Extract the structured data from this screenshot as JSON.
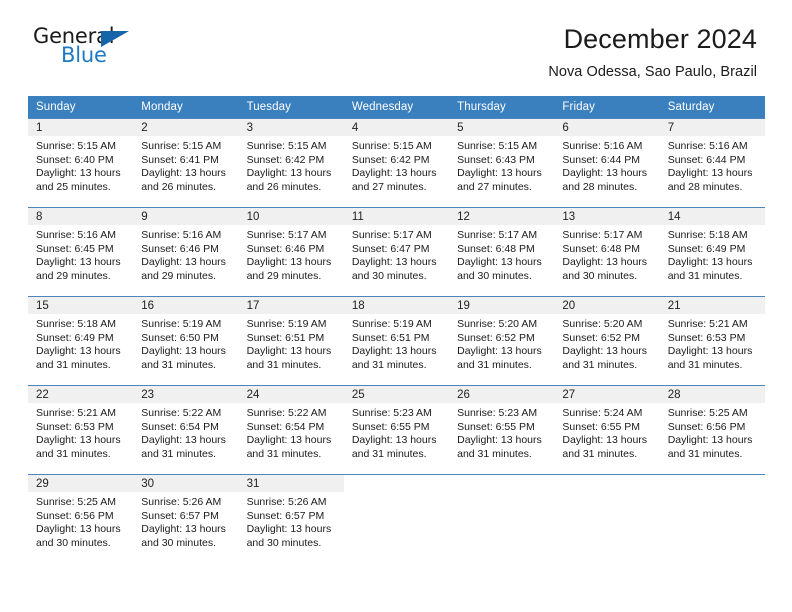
{
  "brand": {
    "name_part1": "General",
    "name_part2": "Blue",
    "triangle_color": "#1565a8",
    "blue_color": "#1f7ac4"
  },
  "header": {
    "title": "December 2024",
    "location": "Nova Odessa, Sao Paulo, Brazil"
  },
  "theme": {
    "header_row_bg": "#3a7fbe",
    "header_row_text": "#ffffff",
    "daynum_bg": "#f0f0f0",
    "cell_border": "#4a86bd",
    "body_text": "#1b1b1b"
  },
  "calendar": {
    "weekday_headers": [
      "Sunday",
      "Monday",
      "Tuesday",
      "Wednesday",
      "Thursday",
      "Friday",
      "Saturday"
    ],
    "labels": {
      "sunrise": "Sunrise:",
      "sunset": "Sunset:",
      "daylight": "Daylight:"
    },
    "weeks": [
      [
        {
          "day": "1",
          "sunrise": "Sunrise: 5:15 AM",
          "sunset": "Sunset: 6:40 PM",
          "daylight_line1": "Daylight: 13 hours",
          "daylight_line2": "and 25 minutes."
        },
        {
          "day": "2",
          "sunrise": "Sunrise: 5:15 AM",
          "sunset": "Sunset: 6:41 PM",
          "daylight_line1": "Daylight: 13 hours",
          "daylight_line2": "and 26 minutes."
        },
        {
          "day": "3",
          "sunrise": "Sunrise: 5:15 AM",
          "sunset": "Sunset: 6:42 PM",
          "daylight_line1": "Daylight: 13 hours",
          "daylight_line2": "and 26 minutes."
        },
        {
          "day": "4",
          "sunrise": "Sunrise: 5:15 AM",
          "sunset": "Sunset: 6:42 PM",
          "daylight_line1": "Daylight: 13 hours",
          "daylight_line2": "and 27 minutes."
        },
        {
          "day": "5",
          "sunrise": "Sunrise: 5:15 AM",
          "sunset": "Sunset: 6:43 PM",
          "daylight_line1": "Daylight: 13 hours",
          "daylight_line2": "and 27 minutes."
        },
        {
          "day": "6",
          "sunrise": "Sunrise: 5:16 AM",
          "sunset": "Sunset: 6:44 PM",
          "daylight_line1": "Daylight: 13 hours",
          "daylight_line2": "and 28 minutes."
        },
        {
          "day": "7",
          "sunrise": "Sunrise: 5:16 AM",
          "sunset": "Sunset: 6:44 PM",
          "daylight_line1": "Daylight: 13 hours",
          "daylight_line2": "and 28 minutes."
        }
      ],
      [
        {
          "day": "8",
          "sunrise": "Sunrise: 5:16 AM",
          "sunset": "Sunset: 6:45 PM",
          "daylight_line1": "Daylight: 13 hours",
          "daylight_line2": "and 29 minutes."
        },
        {
          "day": "9",
          "sunrise": "Sunrise: 5:16 AM",
          "sunset": "Sunset: 6:46 PM",
          "daylight_line1": "Daylight: 13 hours",
          "daylight_line2": "and 29 minutes."
        },
        {
          "day": "10",
          "sunrise": "Sunrise: 5:17 AM",
          "sunset": "Sunset: 6:46 PM",
          "daylight_line1": "Daylight: 13 hours",
          "daylight_line2": "and 29 minutes."
        },
        {
          "day": "11",
          "sunrise": "Sunrise: 5:17 AM",
          "sunset": "Sunset: 6:47 PM",
          "daylight_line1": "Daylight: 13 hours",
          "daylight_line2": "and 30 minutes."
        },
        {
          "day": "12",
          "sunrise": "Sunrise: 5:17 AM",
          "sunset": "Sunset: 6:48 PM",
          "daylight_line1": "Daylight: 13 hours",
          "daylight_line2": "and 30 minutes."
        },
        {
          "day": "13",
          "sunrise": "Sunrise: 5:17 AM",
          "sunset": "Sunset: 6:48 PM",
          "daylight_line1": "Daylight: 13 hours",
          "daylight_line2": "and 30 minutes."
        },
        {
          "day": "14",
          "sunrise": "Sunrise: 5:18 AM",
          "sunset": "Sunset: 6:49 PM",
          "daylight_line1": "Daylight: 13 hours",
          "daylight_line2": "and 31 minutes."
        }
      ],
      [
        {
          "day": "15",
          "sunrise": "Sunrise: 5:18 AM",
          "sunset": "Sunset: 6:49 PM",
          "daylight_line1": "Daylight: 13 hours",
          "daylight_line2": "and 31 minutes."
        },
        {
          "day": "16",
          "sunrise": "Sunrise: 5:19 AM",
          "sunset": "Sunset: 6:50 PM",
          "daylight_line1": "Daylight: 13 hours",
          "daylight_line2": "and 31 minutes."
        },
        {
          "day": "17",
          "sunrise": "Sunrise: 5:19 AM",
          "sunset": "Sunset: 6:51 PM",
          "daylight_line1": "Daylight: 13 hours",
          "daylight_line2": "and 31 minutes."
        },
        {
          "day": "18",
          "sunrise": "Sunrise: 5:19 AM",
          "sunset": "Sunset: 6:51 PM",
          "daylight_line1": "Daylight: 13 hours",
          "daylight_line2": "and 31 minutes."
        },
        {
          "day": "19",
          "sunrise": "Sunrise: 5:20 AM",
          "sunset": "Sunset: 6:52 PM",
          "daylight_line1": "Daylight: 13 hours",
          "daylight_line2": "and 31 minutes."
        },
        {
          "day": "20",
          "sunrise": "Sunrise: 5:20 AM",
          "sunset": "Sunset: 6:52 PM",
          "daylight_line1": "Daylight: 13 hours",
          "daylight_line2": "and 31 minutes."
        },
        {
          "day": "21",
          "sunrise": "Sunrise: 5:21 AM",
          "sunset": "Sunset: 6:53 PM",
          "daylight_line1": "Daylight: 13 hours",
          "daylight_line2": "and 31 minutes."
        }
      ],
      [
        {
          "day": "22",
          "sunrise": "Sunrise: 5:21 AM",
          "sunset": "Sunset: 6:53 PM",
          "daylight_line1": "Daylight: 13 hours",
          "daylight_line2": "and 31 minutes."
        },
        {
          "day": "23",
          "sunrise": "Sunrise: 5:22 AM",
          "sunset": "Sunset: 6:54 PM",
          "daylight_line1": "Daylight: 13 hours",
          "daylight_line2": "and 31 minutes."
        },
        {
          "day": "24",
          "sunrise": "Sunrise: 5:22 AM",
          "sunset": "Sunset: 6:54 PM",
          "daylight_line1": "Daylight: 13 hours",
          "daylight_line2": "and 31 minutes."
        },
        {
          "day": "25",
          "sunrise": "Sunrise: 5:23 AM",
          "sunset": "Sunset: 6:55 PM",
          "daylight_line1": "Daylight: 13 hours",
          "daylight_line2": "and 31 minutes."
        },
        {
          "day": "26",
          "sunrise": "Sunrise: 5:23 AM",
          "sunset": "Sunset: 6:55 PM",
          "daylight_line1": "Daylight: 13 hours",
          "daylight_line2": "and 31 minutes."
        },
        {
          "day": "27",
          "sunrise": "Sunrise: 5:24 AM",
          "sunset": "Sunset: 6:55 PM",
          "daylight_line1": "Daylight: 13 hours",
          "daylight_line2": "and 31 minutes."
        },
        {
          "day": "28",
          "sunrise": "Sunrise: 5:25 AM",
          "sunset": "Sunset: 6:56 PM",
          "daylight_line1": "Daylight: 13 hours",
          "daylight_line2": "and 31 minutes."
        }
      ],
      [
        {
          "day": "29",
          "sunrise": "Sunrise: 5:25 AM",
          "sunset": "Sunset: 6:56 PM",
          "daylight_line1": "Daylight: 13 hours",
          "daylight_line2": "and 30 minutes."
        },
        {
          "day": "30",
          "sunrise": "Sunrise: 5:26 AM",
          "sunset": "Sunset: 6:57 PM",
          "daylight_line1": "Daylight: 13 hours",
          "daylight_line2": "and 30 minutes."
        },
        {
          "day": "31",
          "sunrise": "Sunrise: 5:26 AM",
          "sunset": "Sunset: 6:57 PM",
          "daylight_line1": "Daylight: 13 hours",
          "daylight_line2": "and 30 minutes."
        },
        {
          "day": "",
          "sunrise": "",
          "sunset": "",
          "daylight_line1": "",
          "daylight_line2": ""
        },
        {
          "day": "",
          "sunrise": "",
          "sunset": "",
          "daylight_line1": "",
          "daylight_line2": ""
        },
        {
          "day": "",
          "sunrise": "",
          "sunset": "",
          "daylight_line1": "",
          "daylight_line2": ""
        },
        {
          "day": "",
          "sunrise": "",
          "sunset": "",
          "daylight_line1": "",
          "daylight_line2": ""
        }
      ]
    ]
  }
}
